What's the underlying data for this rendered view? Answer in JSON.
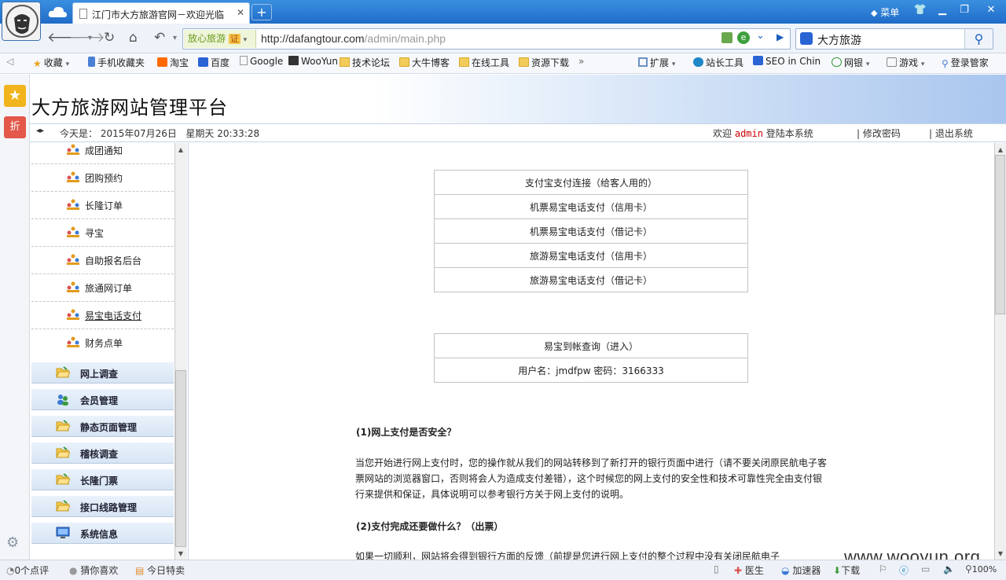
{
  "browser": {
    "tab_title": "江门市大方旅游官网－欢迎光临",
    "new_tab": "+",
    "menu_label": "菜单",
    "cert_label": "放心旅游",
    "cert_badge": "证",
    "url_host": "http://dafangtour.com",
    "url_path": "/admin/main.php",
    "search_value": "大方旅游",
    "bookmarks": [
      "收藏",
      "手机收藏夹",
      "淘宝",
      "百度",
      "Google",
      "WooYun",
      "技术论坛",
      "大牛博客",
      "在线工具",
      "资源下载"
    ],
    "tools": [
      "扩展",
      "站长工具",
      "SEO in Chin",
      "网银",
      "游戏",
      "登录管家"
    ],
    "status": {
      "comments": "0个点评",
      "guess": "猜你喜欢",
      "deals": "今日特卖",
      "doctor": "医生",
      "accelerator": "加速器",
      "download": "下载",
      "zoom": "100%"
    }
  },
  "page": {
    "title": "大方旅游网站管理平台",
    "today_label": "今天是：",
    "date": "2015年07月26日",
    "weekday": "星期天",
    "time": "20:33:28",
    "welcome": "欢迎",
    "user": "admin",
    "login_suffix": "登陆本系统",
    "change_password": "修改密码",
    "logout": "退出系统"
  },
  "sidebar": {
    "subitems": [
      "成团通知",
      "团购预约",
      "长隆订单",
      "寻宝",
      "自助报名后台",
      "旅通网订单",
      "易宝电话支付",
      "财务点单"
    ],
    "groups": [
      "网上调查",
      "会员管理",
      "静态页面管理",
      "稽核调查",
      "长隆门票",
      "接口线路管理",
      "系统信息"
    ]
  },
  "content": {
    "payment_links": [
      "支付宝支付连接（给客人用的）",
      "机票易宝电话支付（信用卡）",
      "机票易宝电话支付（借记卡）",
      "旅游易宝电话支付（信用卡）",
      "旅游易宝电话支付（借记卡）"
    ],
    "query_link": "易宝到帐查询（进入）",
    "credentials": "用户名：jmdfpw 密码：3166333",
    "q1": "(1)网上支付是否安全？",
    "p1": "当您开始进行网上支付时，您的操作就从我们的网站转移到了新打开的银行页面中进行（请不要关闭原民航电子客票网站的浏览器窗口，否则将会人为造成支付差错），这个时候您的网上支付的安全性和技术可靠性完全由支付银行来提供和保证，具体说明可以参考银行方关于网上支付的说明。",
    "q2": "(2)支付完成还要做什么？（出票）",
    "p2": "如果一切顺利，网站将会得到银行方面的反馈（前提是您进行网上支付的整个过程中没有关闭民航电子"
  },
  "watermark": "www.wooyun.org",
  "colors": {
    "title_bar": "#2a7bd6",
    "accent_red": "#cc0000"
  }
}
